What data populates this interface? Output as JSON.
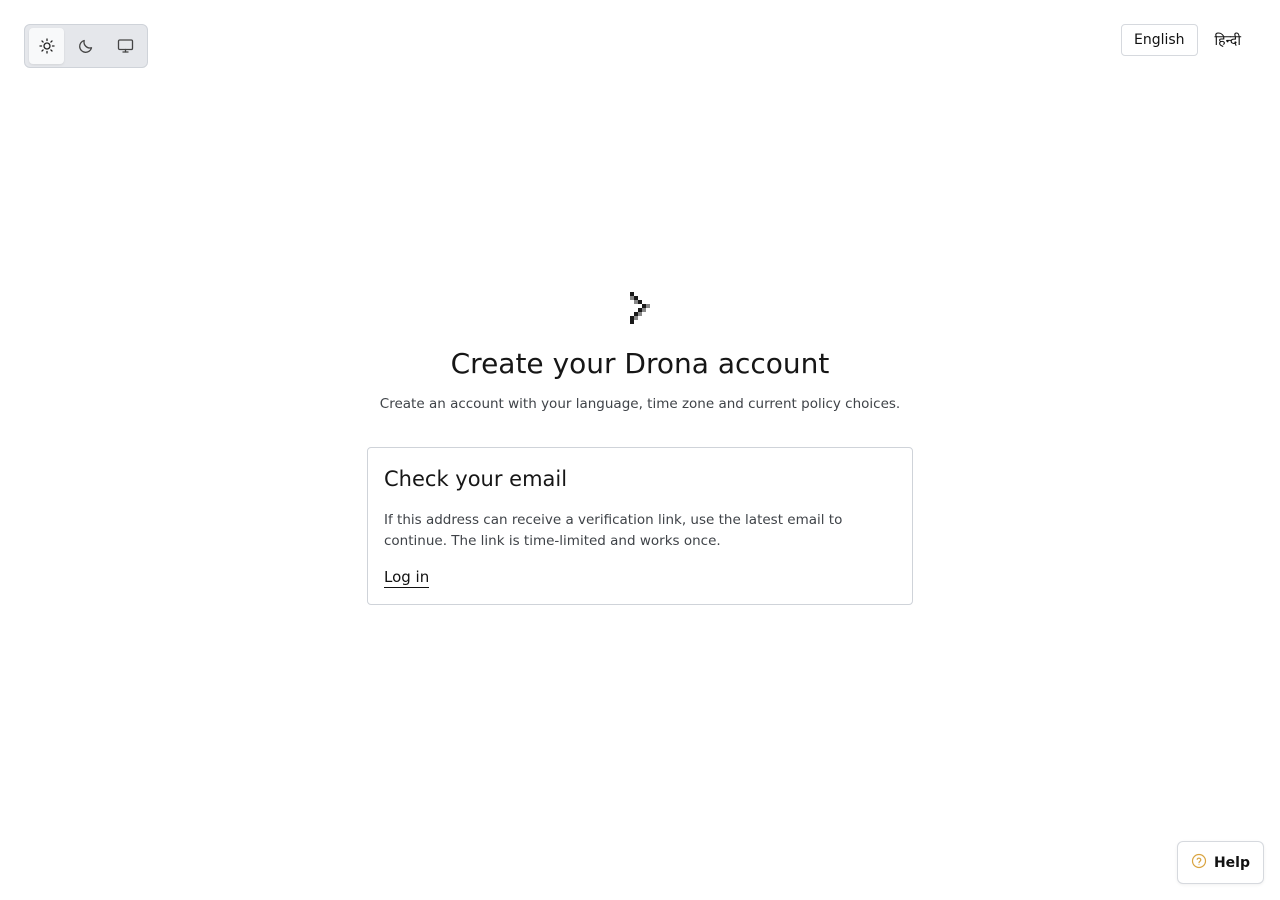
{
  "theme_switcher": {
    "options": [
      {
        "icon": "sun-icon",
        "label": "Light",
        "active": true
      },
      {
        "icon": "moon-icon",
        "label": "Dark",
        "active": false
      },
      {
        "icon": "monitor-icon",
        "label": "System",
        "active": false
      }
    ]
  },
  "language_switcher": {
    "options": [
      {
        "label": "English",
        "active": true
      },
      {
        "label": "हिन्दी",
        "active": false
      }
    ]
  },
  "header": {
    "logo_icon": "drona-logo-icon",
    "title": "Create your Drona account",
    "subtitle": "Create an account with your language, time zone and current policy choices."
  },
  "card": {
    "title": "Check your email",
    "body": "If this address can receive a verification link, use the latest email to continue. The link is time-limited and works once.",
    "login_link": "Log in"
  },
  "help": {
    "label": "Help",
    "icon": "help-circle-icon",
    "icon_color": "#d9a441"
  }
}
